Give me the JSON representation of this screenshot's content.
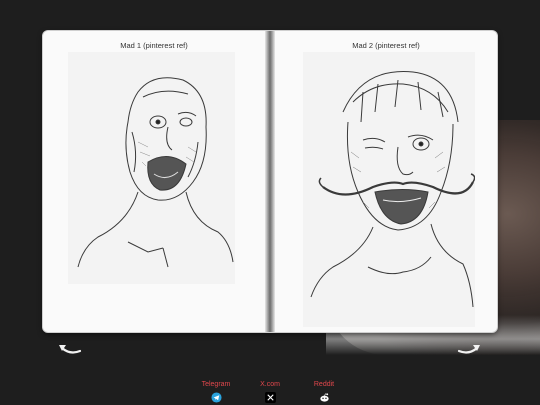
{
  "book": {
    "pages": [
      {
        "title": "Mad 1 (pinterest ref)"
      },
      {
        "title": "Mad 2 (pinterest ref)"
      }
    ]
  },
  "navigation": {
    "prev_icon": "curved-arrow-left-icon",
    "next_icon": "curved-arrow-right-icon"
  },
  "socials": [
    {
      "label": "Telegram",
      "icon": "telegram-icon"
    },
    {
      "label": "X.com",
      "icon": "x-icon"
    },
    {
      "label": "Reddit",
      "icon": "reddit-icon"
    }
  ],
  "colors": {
    "background": "#1e1e1e",
    "page": "#fafafa",
    "link": "#e0474c"
  }
}
